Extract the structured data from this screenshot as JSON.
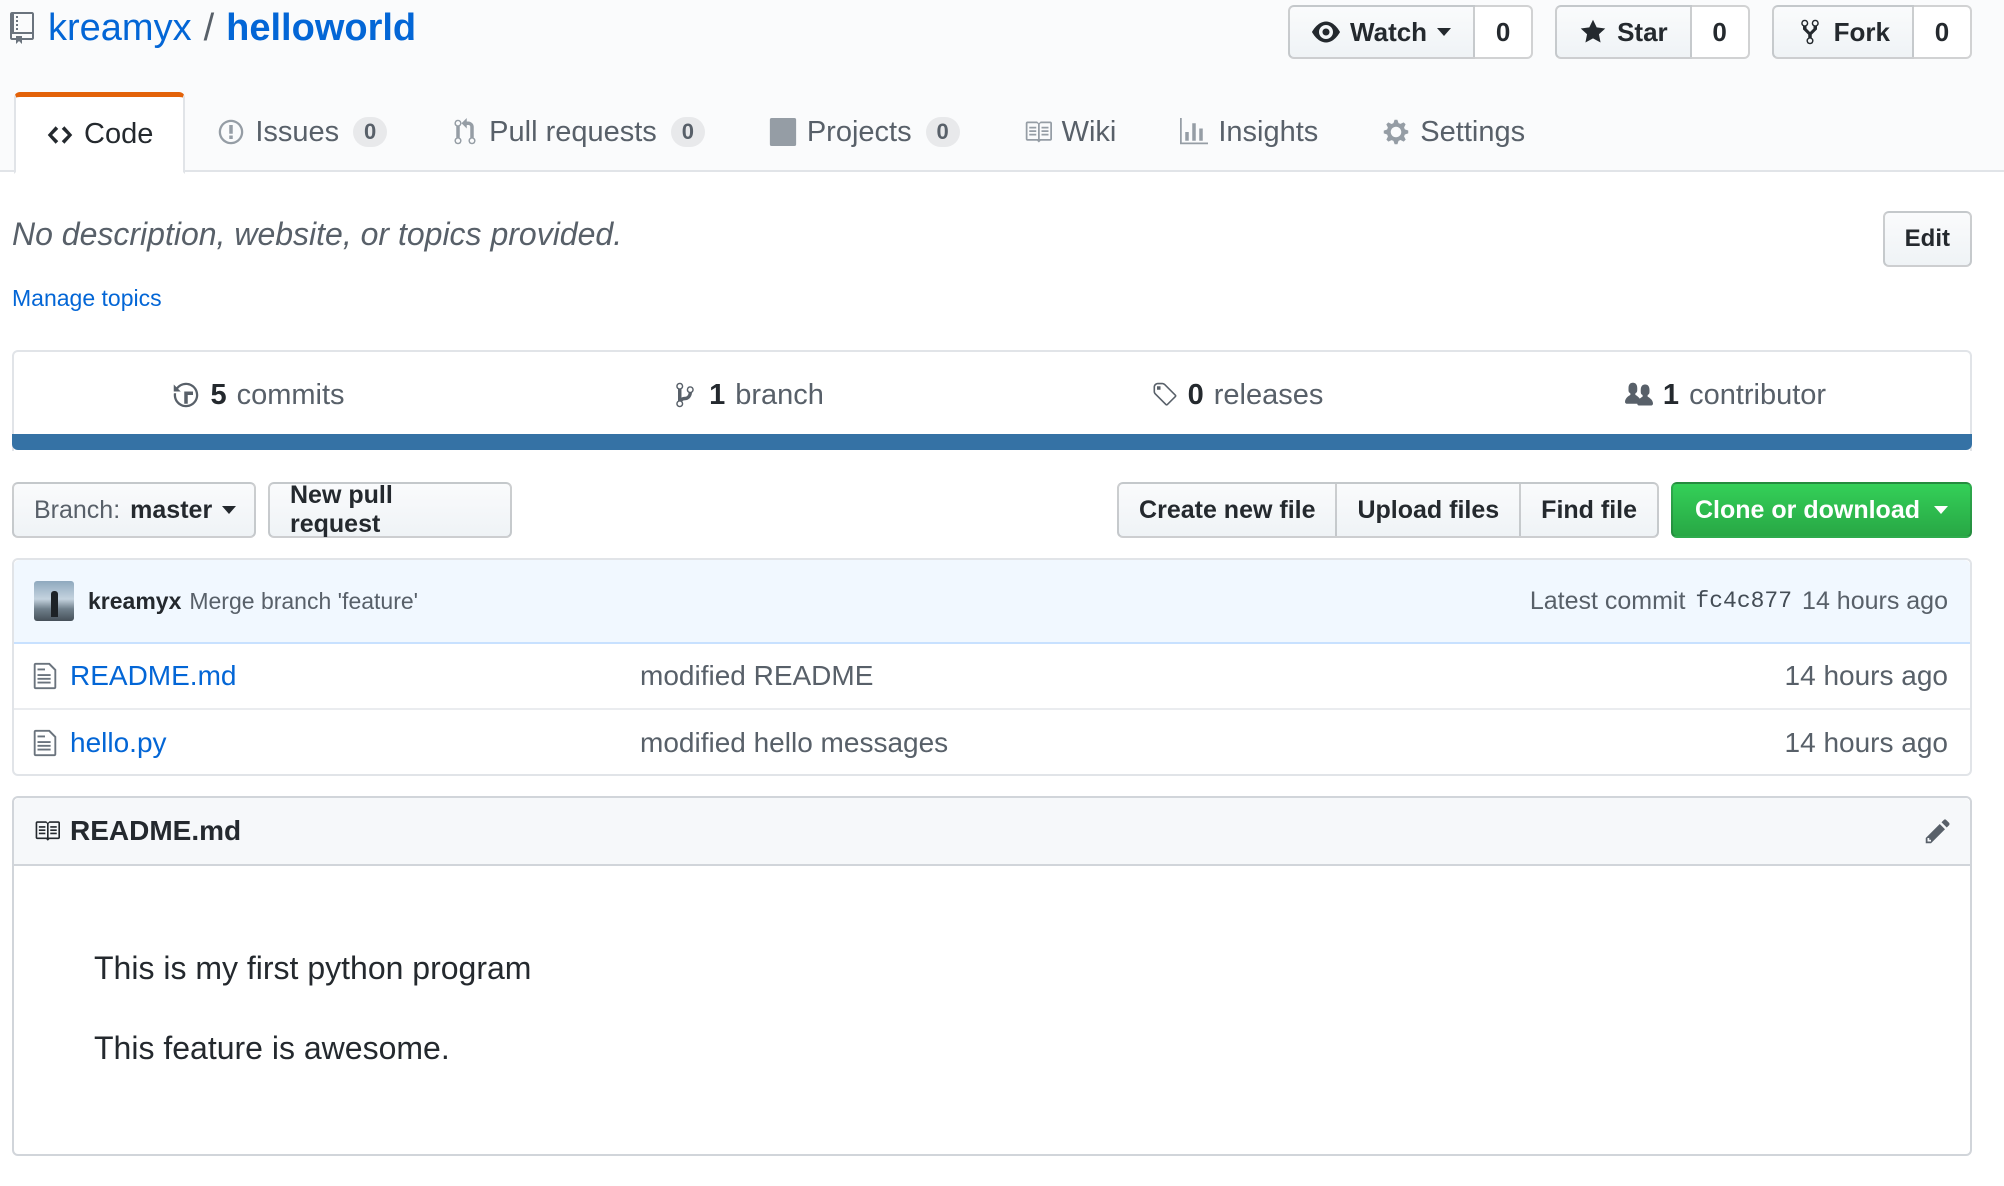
{
  "repo": {
    "owner": "kreamyx",
    "separator": "/",
    "name": "helloworld"
  },
  "actions": {
    "watch_label": "Watch",
    "watch_count": "0",
    "star_label": "Star",
    "star_count": "0",
    "fork_label": "Fork",
    "fork_count": "0"
  },
  "tabs": [
    {
      "label": "Code",
      "icon": "code-icon",
      "selected": true
    },
    {
      "label": "Issues",
      "icon": "issue-icon",
      "counter": "0"
    },
    {
      "label": "Pull requests",
      "icon": "pull-request-icon",
      "counter": "0"
    },
    {
      "label": "Projects",
      "icon": "project-icon",
      "counter": "0"
    },
    {
      "label": "Wiki",
      "icon": "wiki-book-icon"
    },
    {
      "label": "Insights",
      "icon": "graph-icon"
    },
    {
      "label": "Settings",
      "icon": "gear-icon"
    }
  ],
  "description": {
    "text": "No description, website, or topics provided.",
    "edit_label": "Edit",
    "manage_topics": "Manage topics"
  },
  "summary": {
    "commits_num": "5",
    "commits_label": "commits",
    "branch_num": "1",
    "branch_label": "branch",
    "releases_num": "0",
    "releases_label": "releases",
    "contributors_num": "1",
    "contributors_label": "contributor",
    "language_color": "#3572a5"
  },
  "filenav": {
    "branch_prefix": "Branch:",
    "branch_name": "master",
    "new_pull_request": "New pull request",
    "create_new_file": "Create new file",
    "upload_files": "Upload files",
    "find_file": "Find file",
    "clone_or_download": "Clone or download"
  },
  "latest_commit": {
    "author": "kreamyx",
    "message": "Merge branch 'feature'",
    "prefix": "Latest commit",
    "sha": "fc4c877",
    "age": "14 hours ago"
  },
  "files": [
    {
      "name": "README.md",
      "message": "modified README",
      "age": "14 hours ago"
    },
    {
      "name": "hello.py",
      "message": "modified hello messages",
      "age": "14 hours ago"
    }
  ],
  "readme": {
    "title": "README.md",
    "paragraphs": [
      "This is my first python program",
      "This feature is awesome."
    ]
  }
}
